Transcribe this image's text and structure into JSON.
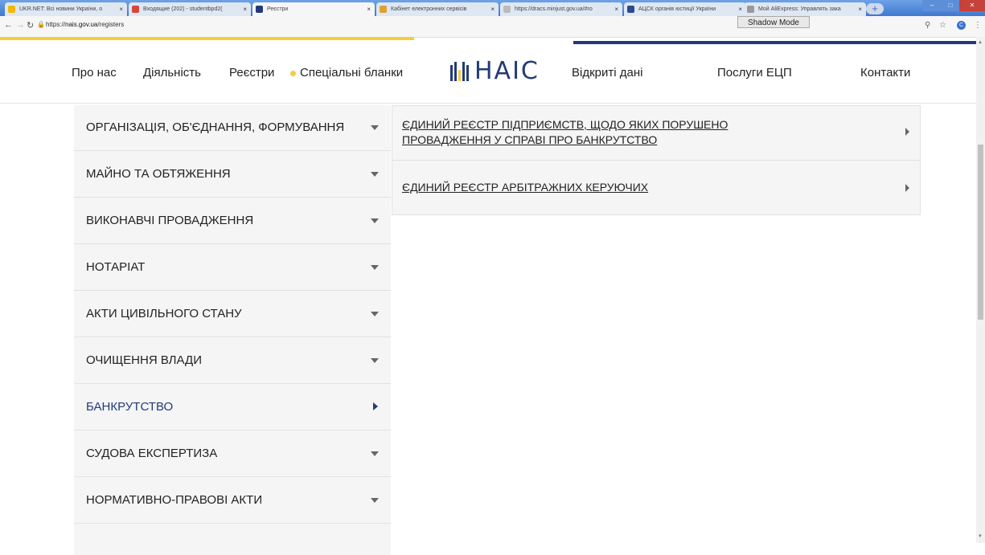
{
  "browser": {
    "tabs": [
      {
        "title": "UKR.NET: Всі новини України, о",
        "fav": "#f5b800"
      },
      {
        "title": "Входящие (202) - studentbpd2(",
        "fav": "#d94437"
      },
      {
        "title": "Реєстри",
        "fav": "#233a7a"
      },
      {
        "title": "Кабінет електронних сервісів",
        "fav": "#e0a030"
      },
      {
        "title": "https://dracs.minjust.gov.ua/#ro",
        "fav": "#bbbbbb"
      },
      {
        "title": "АЦСК органів юстиції України",
        "fav": "#2b4a8a"
      },
      {
        "title": "Мой AliExpress: Управлять зака",
        "fav": "#999999"
      }
    ],
    "tab_close": "×",
    "new_tab": "+",
    "shadow_mode": "Shadow Mode",
    "url_prefix": "https://",
    "url_host": "nais.gov.ua",
    "url_path": "/registers",
    "profile_initial": "C"
  },
  "site": {
    "nav_left": [
      "Про нас",
      "Діяльність",
      "Реєстри",
      "Спеціальні бланки"
    ],
    "logo_text": "НАІС",
    "nav_right": [
      "Відкриті дані",
      "Послуги ЕЦП",
      "Контакти"
    ]
  },
  "menu": {
    "items": [
      {
        "label": "ОРГАНІЗАЦІЯ, ОБ'ЄДНАННЯ, ФОРМУВАННЯ",
        "active": false
      },
      {
        "label": "МАЙНО ТА ОБТЯЖЕННЯ",
        "active": false
      },
      {
        "label": "ВИКОНАВЧІ ПРОВАДЖЕННЯ",
        "active": false
      },
      {
        "label": "НОТАРІАТ",
        "active": false
      },
      {
        "label": "АКТИ ЦИВІЛЬНОГО СТАНУ",
        "active": false
      },
      {
        "label": "ОЧИЩЕННЯ ВЛАДИ",
        "active": false
      },
      {
        "label": "БАНКРУТСТВО",
        "active": true
      },
      {
        "label": "СУДОВА ЕКСПЕРТИЗА",
        "active": false
      },
      {
        "label": "НОРМАТИВНО-ПРАВОВІ АКТИ",
        "active": false
      }
    ]
  },
  "submenu": {
    "items": [
      {
        "line1": "ЄДИНИЙ РЕЄСТР ПІДПРИЄМСТВ, ЩОДО ЯКИХ ПОРУШЕНО",
        "line2": "ПРОВАДЖЕННЯ У СПРАВІ ПРО БАНКРУТСТВО"
      },
      {
        "line1": "ЄДИНИЙ РЕЄСТР АРБІТРАЖНИХ КЕРУЮЧИХ",
        "line2": ""
      }
    ]
  },
  "colors": {
    "accent_yellow": "#f5cd3b",
    "brand_navy": "#233a7a"
  }
}
